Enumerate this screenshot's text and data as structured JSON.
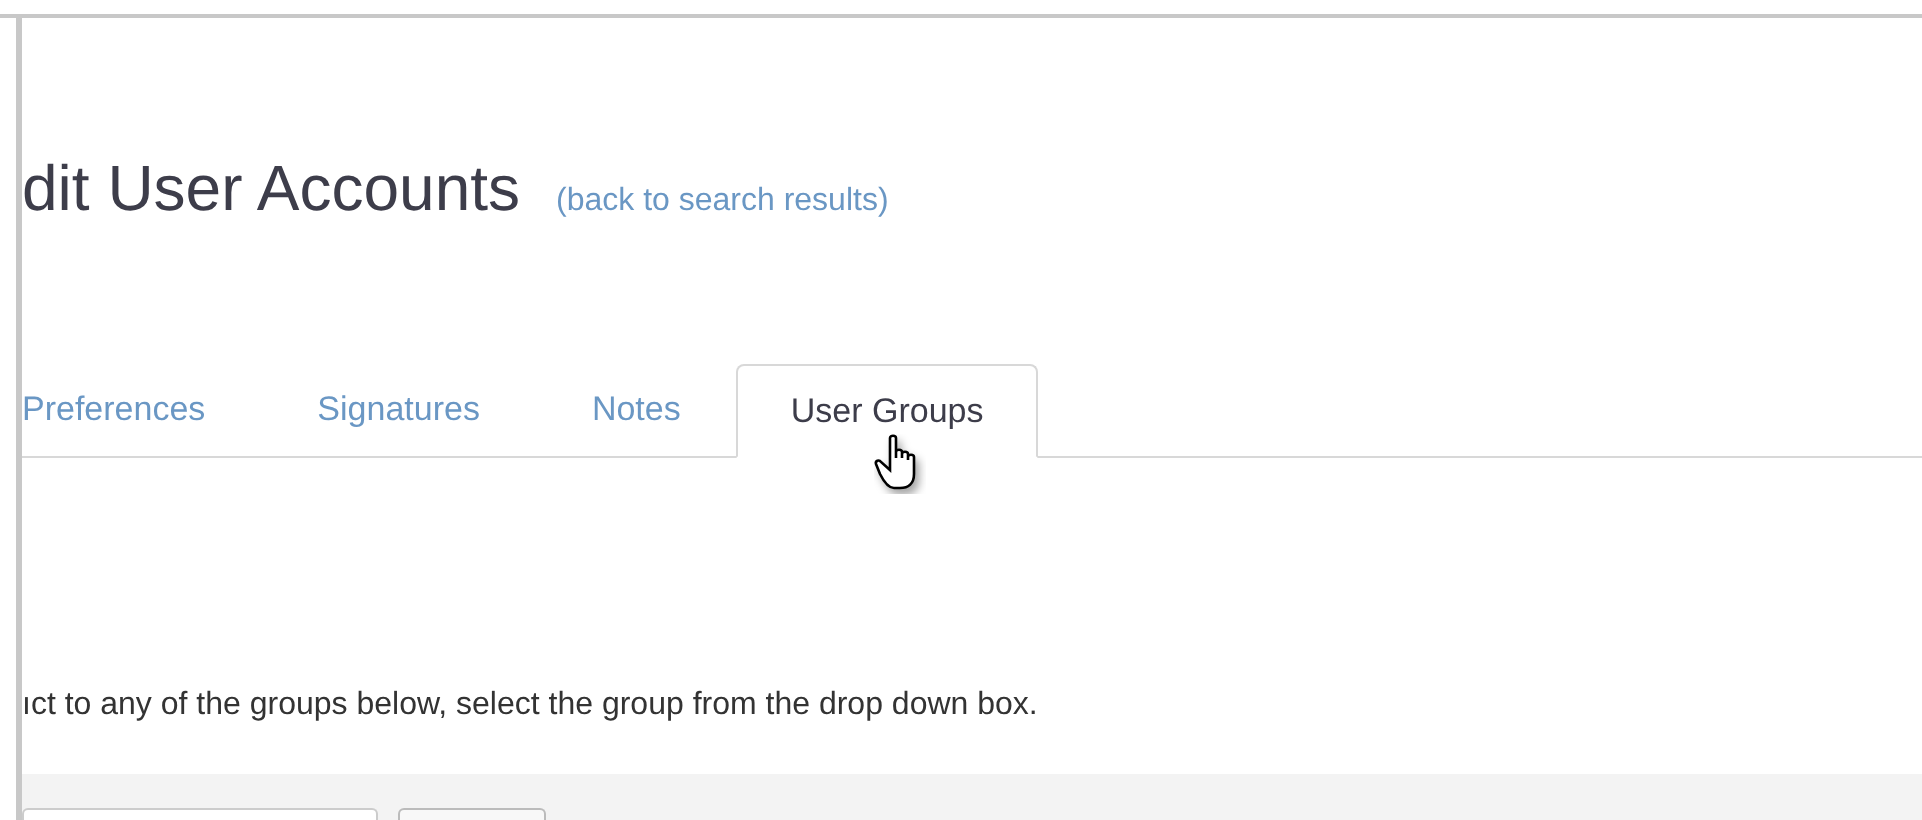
{
  "heading": {
    "title": "dit User Accounts",
    "back_link": "(back to search results)"
  },
  "tabs": [
    {
      "label": "Preferences",
      "selected": false
    },
    {
      "label": "Signatures",
      "selected": false
    },
    {
      "label": "Notes",
      "selected": false
    },
    {
      "label": "User Groups",
      "selected": true
    }
  ],
  "instructions": "ıct to any of the groups below, select the group from the drop down box."
}
